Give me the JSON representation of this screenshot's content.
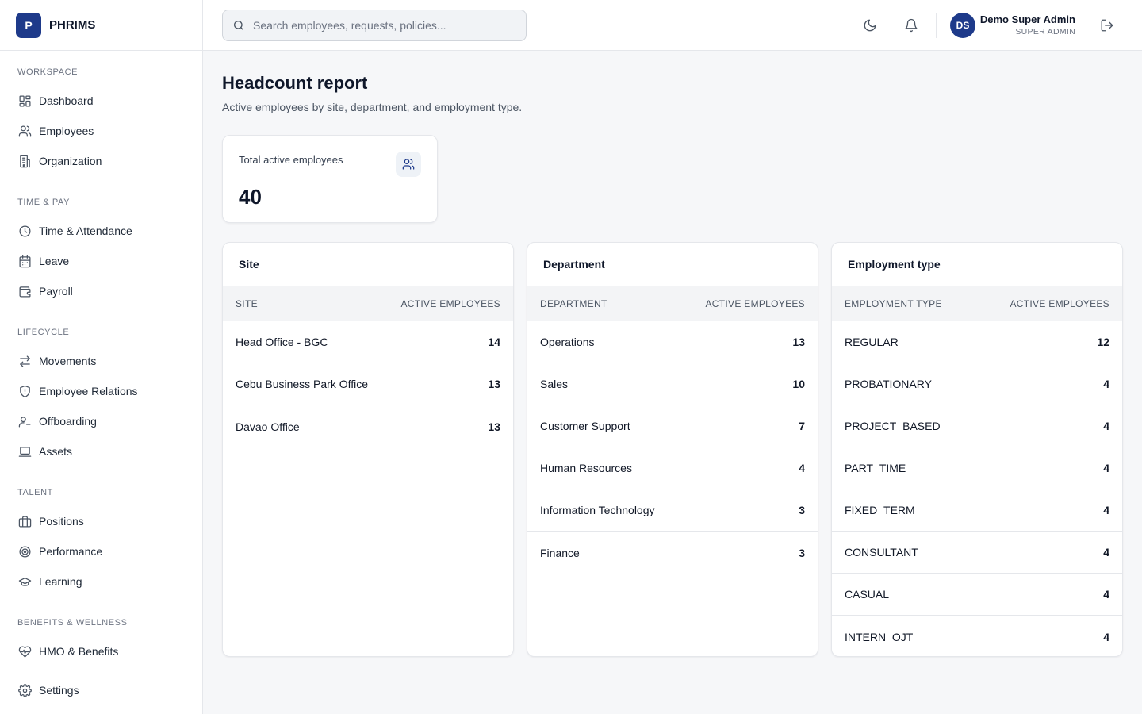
{
  "brand": {
    "logo_letter": "P",
    "name": "PHRIMS"
  },
  "sidebar": {
    "sections": [
      {
        "title": "WORKSPACE",
        "items": [
          {
            "label": "Dashboard",
            "icon": "dashboard-icon"
          },
          {
            "label": "Employees",
            "icon": "users-icon"
          },
          {
            "label": "Organization",
            "icon": "building-icon"
          }
        ]
      },
      {
        "title": "TIME & PAY",
        "items": [
          {
            "label": "Time & Attendance",
            "icon": "clock-icon"
          },
          {
            "label": "Leave",
            "icon": "calendar-icon"
          },
          {
            "label": "Payroll",
            "icon": "wallet-icon"
          }
        ]
      },
      {
        "title": "LIFECYCLE",
        "items": [
          {
            "label": "Movements",
            "icon": "arrows-icon"
          },
          {
            "label": "Employee Relations",
            "icon": "shield-icon"
          },
          {
            "label": "Offboarding",
            "icon": "user-minus-icon"
          },
          {
            "label": "Assets",
            "icon": "laptop-icon"
          }
        ]
      },
      {
        "title": "TALENT",
        "items": [
          {
            "label": "Positions",
            "icon": "briefcase-icon"
          },
          {
            "label": "Performance",
            "icon": "target-icon"
          },
          {
            "label": "Learning",
            "icon": "graduation-cap-icon"
          }
        ]
      },
      {
        "title": "BENEFITS & WELLNESS",
        "items": [
          {
            "label": "HMO & Benefits",
            "icon": "heart-pulse-icon"
          }
        ]
      }
    ],
    "footer_label": "Settings"
  },
  "topbar": {
    "search_placeholder": "Search employees, requests, policies...",
    "user_initials": "DS",
    "user_name": "Demo Super Admin",
    "user_role": "SUPER ADMIN"
  },
  "page": {
    "title": "Headcount report",
    "subtitle": "Active employees by site, department, and employment type."
  },
  "stat": {
    "label": "Total active employees",
    "value": "40"
  },
  "tables": {
    "site": {
      "title": "Site",
      "col1": "SITE",
      "col2": "ACTIVE EMPLOYEES",
      "rows": [
        {
          "name": "Head Office - BGC",
          "count": "14"
        },
        {
          "name": "Cebu Business Park Office",
          "count": "13"
        },
        {
          "name": "Davao Office",
          "count": "13"
        }
      ]
    },
    "department": {
      "title": "Department",
      "col1": "DEPARTMENT",
      "col2": "ACTIVE EMPLOYEES",
      "rows": [
        {
          "name": "Operations",
          "count": "13"
        },
        {
          "name": "Sales",
          "count": "10"
        },
        {
          "name": "Customer Support",
          "count": "7"
        },
        {
          "name": "Human Resources",
          "count": "4"
        },
        {
          "name": "Information Technology",
          "count": "3"
        },
        {
          "name": "Finance",
          "count": "3"
        }
      ]
    },
    "employment_type": {
      "title": "Employment type",
      "col1": "EMPLOYMENT TYPE",
      "col2": "ACTIVE EMPLOYEES",
      "rows": [
        {
          "name": "REGULAR",
          "count": "12"
        },
        {
          "name": "PROBATIONARY",
          "count": "4"
        },
        {
          "name": "PROJECT_BASED",
          "count": "4"
        },
        {
          "name": "PART_TIME",
          "count": "4"
        },
        {
          "name": "FIXED_TERM",
          "count": "4"
        },
        {
          "name": "CONSULTANT",
          "count": "4"
        },
        {
          "name": "CASUAL",
          "count": "4"
        },
        {
          "name": "INTERN_OJT",
          "count": "4"
        }
      ]
    }
  },
  "colors": {
    "brand": "#1e3a8a",
    "background": "#f6f7f9",
    "border": "#e5e7eb"
  }
}
